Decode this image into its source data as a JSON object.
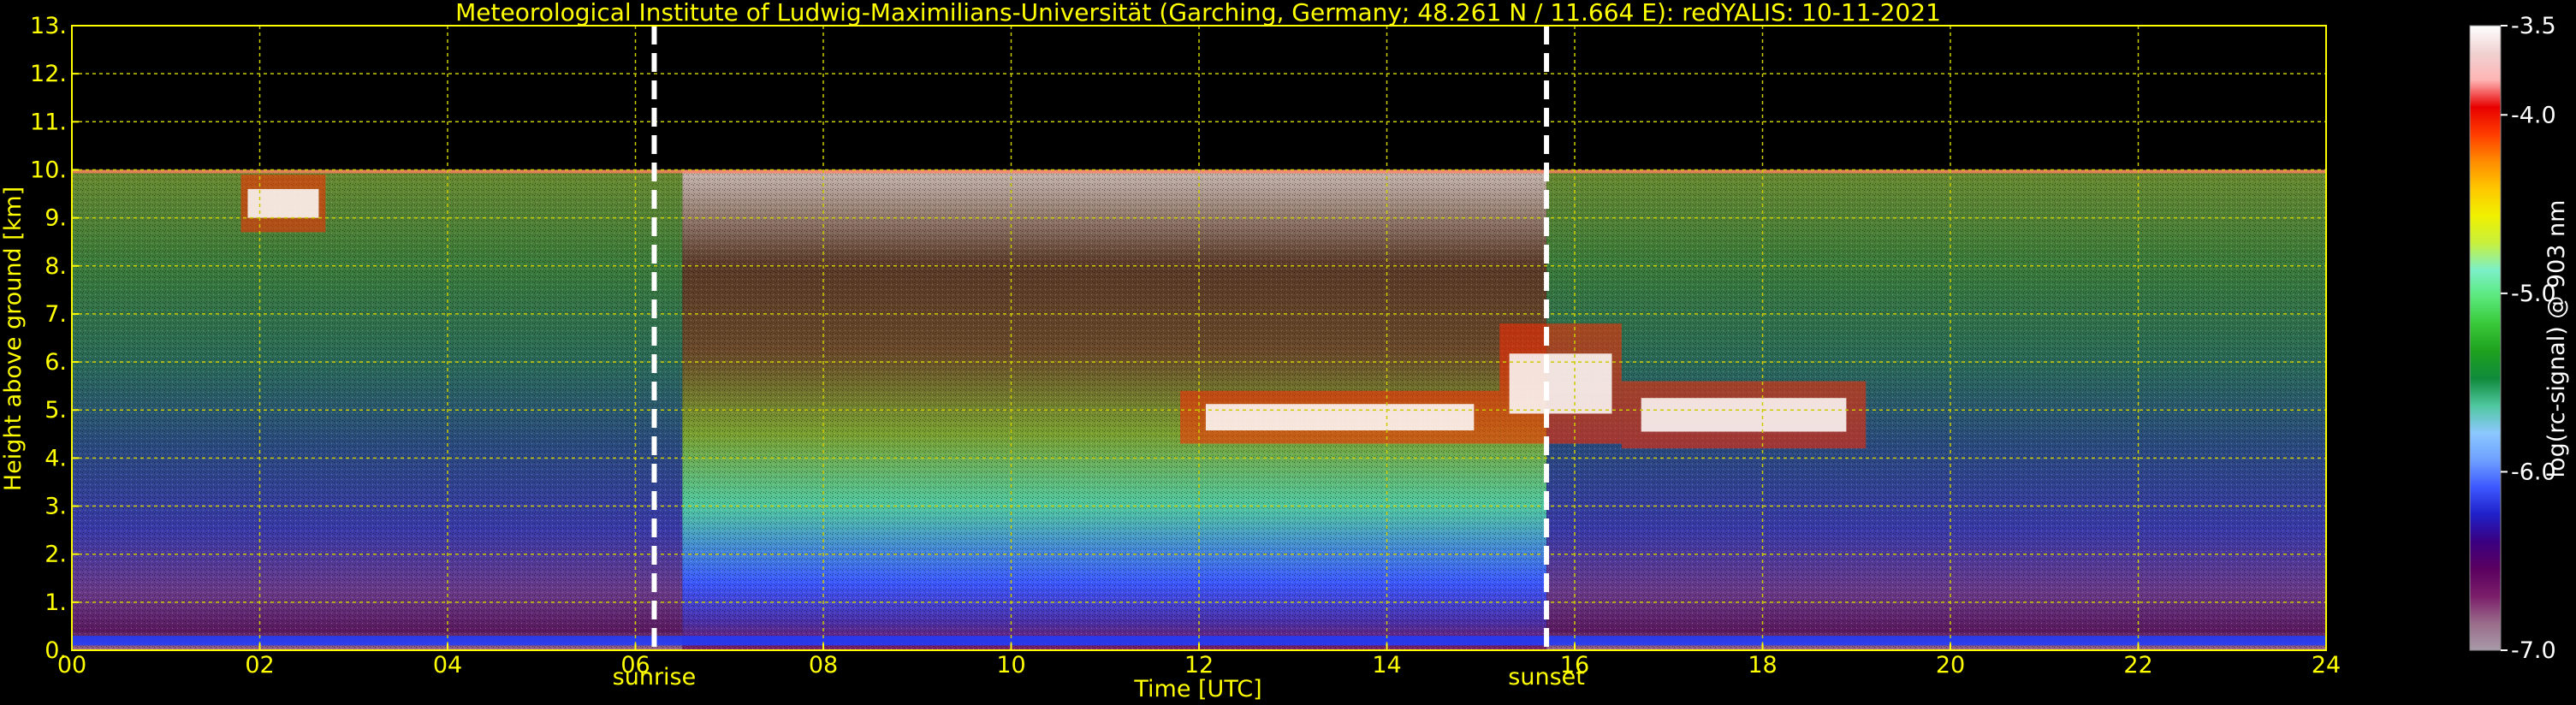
{
  "chart_data": {
    "type": "heatmap",
    "title": "Meteorological Institute of Ludwig-Maximilians-Universität (Garching, Germany; 48.261 N / 11.664 E):    redYALIS: 10-11-2021",
    "xlabel": "Time [UTC]",
    "ylabel": "Height above ground [km]",
    "xlim": [
      0,
      24
    ],
    "ylim": [
      0,
      13
    ],
    "xticks": [
      "00",
      "02",
      "04",
      "06",
      "08",
      "10",
      "12",
      "14",
      "16",
      "18",
      "20",
      "22",
      "24"
    ],
    "xtick_values": [
      0,
      2,
      4,
      6,
      8,
      10,
      12,
      14,
      16,
      18,
      20,
      22,
      24
    ],
    "yticks": [
      "0.",
      "1.",
      "2.",
      "3.",
      "4.",
      "5.",
      "6.",
      "7.",
      "8.",
      "9.",
      "10.",
      "11.",
      "12.",
      "13."
    ],
    "ytick_values": [
      0,
      1,
      2,
      3,
      4,
      5,
      6,
      7,
      8,
      9,
      10,
      11,
      12,
      13
    ],
    "data_top_km": 10,
    "grid": true,
    "markers": [
      {
        "label": "sunrise",
        "x": 6.2
      },
      {
        "label": "sunset",
        "x": 15.7
      }
    ],
    "colorbar": {
      "label": "log(rc-signal) @ 903 nm",
      "range": [
        -7.0,
        -3.5
      ],
      "ticks": [
        "-3.5",
        "-4.0",
        "-5.0",
        "-6.0",
        "-7.0"
      ],
      "tick_values": [
        -3.5,
        -4.0,
        -5.0,
        -6.0,
        -7.0
      ],
      "colors": [
        "#a89aa8",
        "#9a6b8a",
        "#7a1d6a",
        "#5a0060",
        "#3a0080",
        "#2020c8",
        "#3c58ff",
        "#6ea0ff",
        "#8cc8ff",
        "#50c8a0",
        "#108a3c",
        "#1ea01e",
        "#38c838",
        "#5ae87a",
        "#7cf0c8",
        "#c8f03c",
        "#f0f000",
        "#ffc800",
        "#ff8c00",
        "#ff3c00",
        "#e80000",
        "#ffb4b4",
        "#f0d2d2",
        "#ffffff"
      ]
    },
    "features": [
      {
        "name": "cloud",
        "x_range": [
          11.8,
          15.2
        ],
        "height_km": [
          4.3,
          5.4
        ]
      },
      {
        "name": "cloud",
        "x_range": [
          15.2,
          16.5
        ],
        "height_km": [
          4.3,
          6.8
        ]
      },
      {
        "name": "cloud",
        "x_range": [
          16.5,
          19.1
        ],
        "height_km": [
          4.2,
          5.6
        ]
      },
      {
        "name": "cloud",
        "x_range": [
          1.8,
          2.7
        ],
        "height_km": [
          8.7,
          9.9
        ]
      }
    ]
  }
}
